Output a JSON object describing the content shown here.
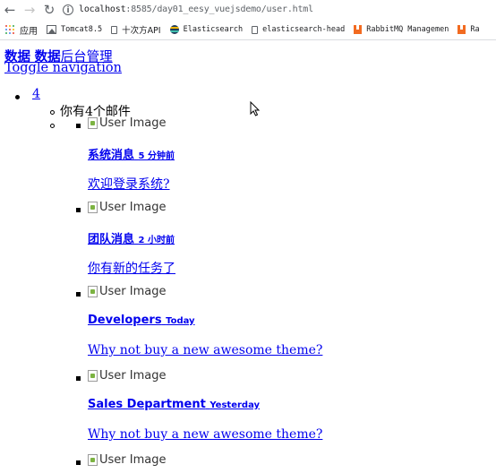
{
  "browser": {
    "url_host": "localhost",
    "url_path": ":8585/day01_eesy_vuejsdemo/user.html",
    "bookmarks": [
      {
        "label": "应用",
        "icon": "apps-grid-icon"
      },
      {
        "label": "Tomcat8.5",
        "icon": "image-icon"
      },
      {
        "label": "十次方API",
        "icon": "document-icon"
      },
      {
        "label": "Elasticsearch",
        "icon": "elasticsearch-icon"
      },
      {
        "label": "elasticsearch-head",
        "icon": "document-icon"
      },
      {
        "label": "RabbitMQ Managemen",
        "icon": "rabbitmq-icon"
      },
      {
        "label": "Ra",
        "icon": "rabbitmq-icon"
      }
    ]
  },
  "header": {
    "logo_mini": "数据",
    "logo_bold": "数据",
    "logo_rest": "后台管理",
    "toggle": "Toggle navigation"
  },
  "notifications": {
    "count": "4",
    "header": "你有4个邮件",
    "image_alt": "User Image",
    "items": [
      {
        "title": "系统消息",
        "time": "5 分钟前",
        "body": "欢迎登录系统?"
      },
      {
        "title": "团队消息",
        "time": "2 小时前",
        "body": "你有新的任务了"
      },
      {
        "title": "Developers",
        "time": "Today",
        "body": "Why not buy a new awesome theme?"
      },
      {
        "title": "Sales Department",
        "time": "Yesterday",
        "body": "Why not buy a new awesome theme?"
      }
    ]
  },
  "colors": {
    "link": "#0000ee",
    "apps_grid": [
      "#ea4335",
      "#fbbc05",
      "#34a853",
      "#4285f4"
    ]
  }
}
